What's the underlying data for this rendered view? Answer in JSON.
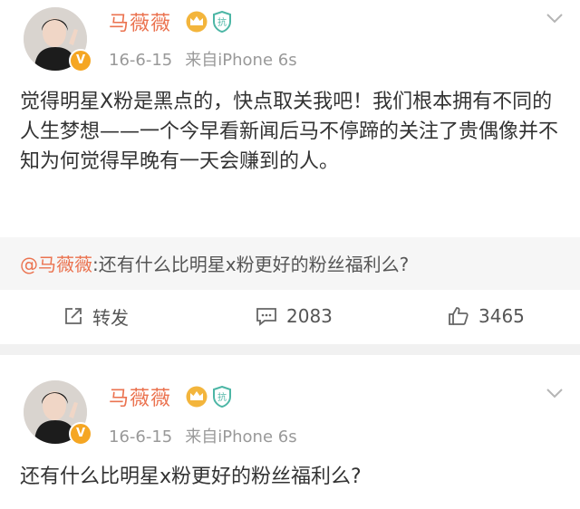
{
  "colors": {
    "name": "#eb7350",
    "meta": "#999999",
    "text": "#333333",
    "repost_bg": "#f6f6f6",
    "divider": "#f1f1f1",
    "vbadge": "#f5a623"
  },
  "post1": {
    "author": "马薇薇",
    "date": "16-6-15",
    "source": "来自",
    "device": "iPhone 6s",
    "verified_mark": "V",
    "vip_icon": "crown-icon",
    "badge_icon": "shield-badge-icon",
    "body": "觉得明星X粉是黑点的，快点取关我吧！我们根本拥有不同的人生梦想——一个今早看新闻后马不停蹄的关注了贵偶像并不知为何觉得早晚有一天会赚到的人。",
    "repost": {
      "mention": "@马薇薇",
      "text": ":还有什么比明星x粉更好的粉丝福利么?"
    },
    "actions": {
      "share_label": "转发",
      "comment_count": "2083",
      "like_count": "3465"
    }
  },
  "post2": {
    "author": "马薇薇",
    "date": "16-6-15",
    "source": "来自",
    "device": "iPhone 6s",
    "verified_mark": "V",
    "body": "还有什么比明星x粉更好的粉丝福利么?"
  }
}
